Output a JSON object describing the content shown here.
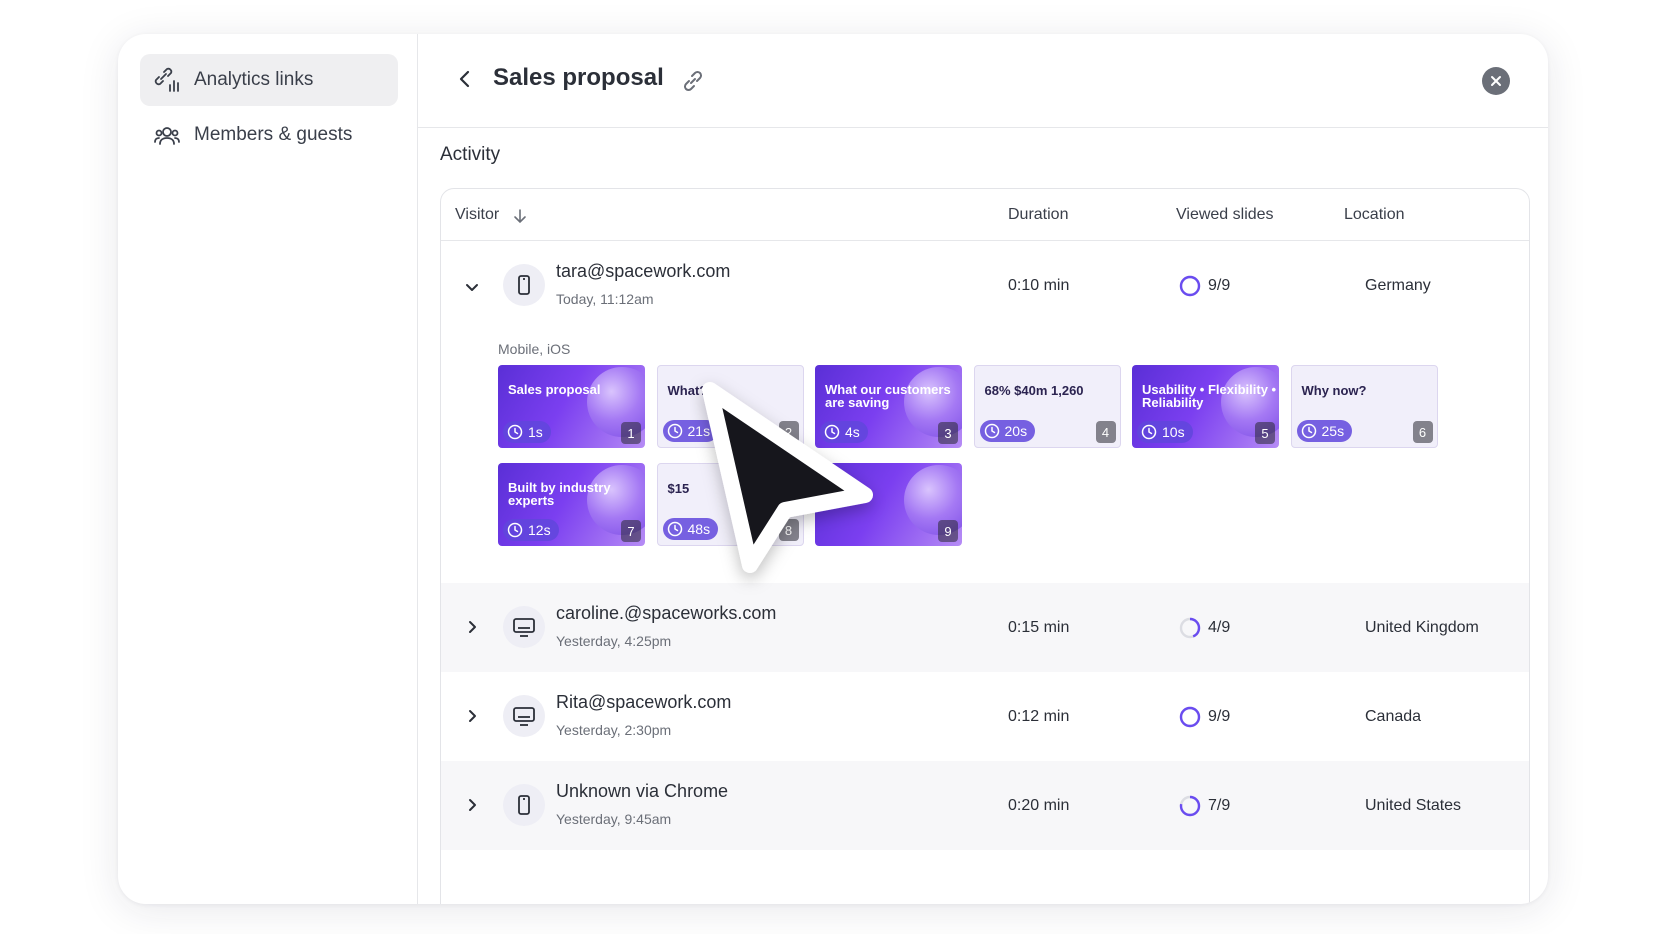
{
  "sidebar": {
    "items": [
      {
        "label": "Analytics links",
        "icon": "analytics-link-icon",
        "active": true
      },
      {
        "label": "Members & guests",
        "icon": "members-icon",
        "active": false
      }
    ]
  },
  "header": {
    "title": "Sales proposal"
  },
  "activity": {
    "title": "Activity",
    "columns": {
      "visitor": "Visitor",
      "duration": "Duration",
      "viewed_slides": "Viewed slides",
      "location": "Location"
    },
    "rows": [
      {
        "email": "tara@spacework.com",
        "time": "Today, 11:12am",
        "device": "mobile",
        "duration": "0:10 min",
        "slides": "9/9",
        "progress": 1.0,
        "location": "Germany",
        "expanded": true
      },
      {
        "email": "caroline.@spaceworks.com",
        "time": "Yesterday, 4:25pm",
        "device": "desktop",
        "duration": "0:15 min",
        "slides": "4/9",
        "progress": 0.44,
        "location": "United Kingdom",
        "expanded": false
      },
      {
        "email": "Rita@spacework.com",
        "time": "Yesterday, 2:30pm",
        "device": "desktop",
        "duration": "0:12 min",
        "slides": "9/9",
        "progress": 1.0,
        "location": "Canada",
        "expanded": false
      },
      {
        "email": "Unknown via Chrome",
        "time": "Yesterday, 9:45am",
        "device": "mobile",
        "duration": "0:20 min",
        "slides": "7/9",
        "progress": 0.78,
        "location": "United States",
        "expanded": false
      }
    ],
    "expanded_detail": {
      "device_info": "Mobile, iOS",
      "thumbnails": [
        {
          "n": "1",
          "time": "1s",
          "title": "Sales proposal",
          "style": "dark"
        },
        {
          "n": "2",
          "time": "21s",
          "title": "What?",
          "style": "light"
        },
        {
          "n": "3",
          "time": "4s",
          "title": "What our customers are saving",
          "style": "dark"
        },
        {
          "n": "4",
          "time": "20s",
          "title": "68%  $40m  1,260",
          "style": "light"
        },
        {
          "n": "5",
          "time": "10s",
          "title": "Usability • Flexibility • Reliability",
          "style": "dark"
        },
        {
          "n": "6",
          "time": "25s",
          "title": "Why now?",
          "style": "light"
        },
        {
          "n": "7",
          "time": "12s",
          "title": "Built by industry experts",
          "style": "dark"
        },
        {
          "n": "8",
          "time": "48s",
          "title": "$15",
          "style": "light"
        },
        {
          "n": "9",
          "time": "",
          "title": "you!",
          "style": "dark"
        }
      ]
    }
  },
  "colors": {
    "accent": "#6a4cf0",
    "thumb_dark": "#6b35e6",
    "ring_track": "#dcdde3"
  }
}
